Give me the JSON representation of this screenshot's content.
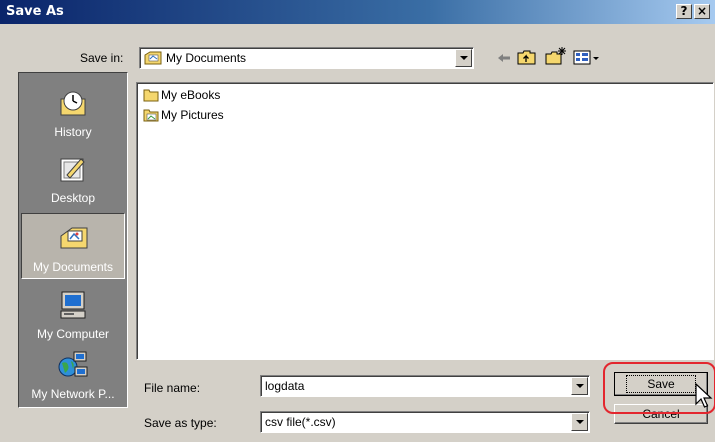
{
  "window": {
    "title": "Save As",
    "help_label": "?",
    "close_label": "×"
  },
  "toolbar": {
    "save_in_label": "Save in:",
    "save_in_value": "My Documents",
    "back_icon": "arrow-left",
    "up_icon": "folder-up",
    "new_folder_icon": "new-folder",
    "views_icon": "views-menu"
  },
  "places": [
    {
      "label": "History",
      "icon": "history-icon",
      "selected": false
    },
    {
      "label": "Desktop",
      "icon": "desktop-icon",
      "selected": false
    },
    {
      "label": "My Documents",
      "icon": "my-documents-icon",
      "selected": true
    },
    {
      "label": "My Computer",
      "icon": "my-computer-icon",
      "selected": false
    },
    {
      "label": "My Network P...",
      "icon": "network-places-icon",
      "selected": false
    }
  ],
  "files": [
    {
      "name": "My eBooks",
      "icon": "folder-icon"
    },
    {
      "name": "My Pictures",
      "icon": "pictures-folder-icon"
    }
  ],
  "form": {
    "file_name_label": "File name:",
    "file_name_value": "logdata",
    "save_type_label": "Save as type:",
    "save_type_value": "csv file(*.csv)"
  },
  "buttons": {
    "save_label": "Save",
    "cancel_label": "Cancel"
  },
  "colors": {
    "titlebar_start": "#0a246a",
    "dialog_bg": "#d4d0c8",
    "highlight_ring": "#e3262e"
  }
}
